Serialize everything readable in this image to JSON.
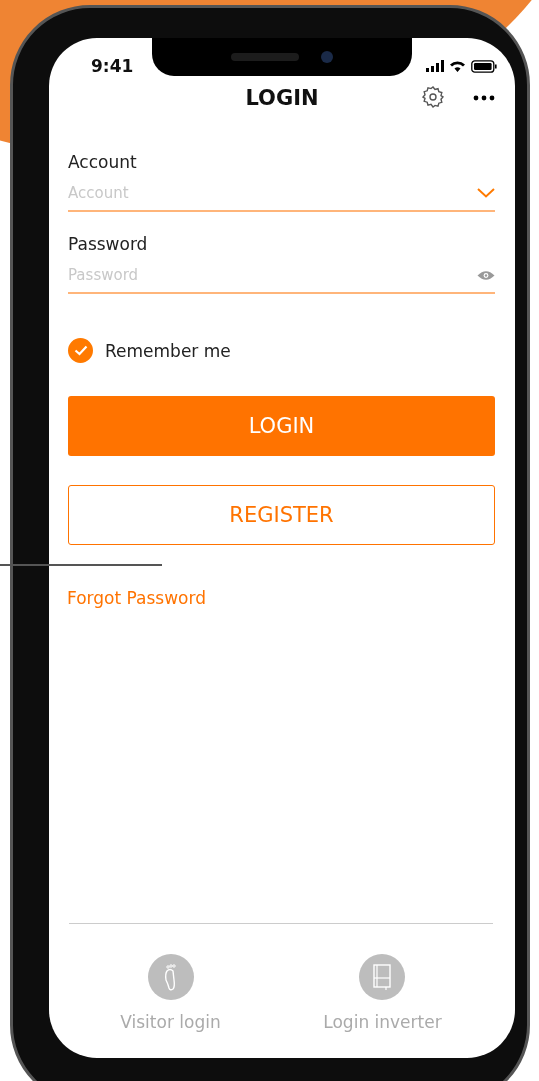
{
  "status_bar": {
    "time": "9:41"
  },
  "header": {
    "title": "LOGIN"
  },
  "form": {
    "fields": [
      {
        "label": "Account",
        "placeholder": "Account",
        "kind": "dropdown"
      },
      {
        "label": "Password",
        "placeholder": "Password",
        "kind": "password"
      }
    ],
    "remember": {
      "label": "Remember me",
      "checked": true
    },
    "buttons": [
      {
        "label": "LOGIN",
        "kind": "primary"
      },
      {
        "label": "REGISTER",
        "kind": "outline"
      }
    ],
    "forgot_link": "Forgot Password"
  },
  "footer": {
    "items": [
      {
        "label": "Visitor login",
        "kind": "visitor"
      },
      {
        "label": "Login inverter",
        "kind": "inverter"
      }
    ]
  }
}
